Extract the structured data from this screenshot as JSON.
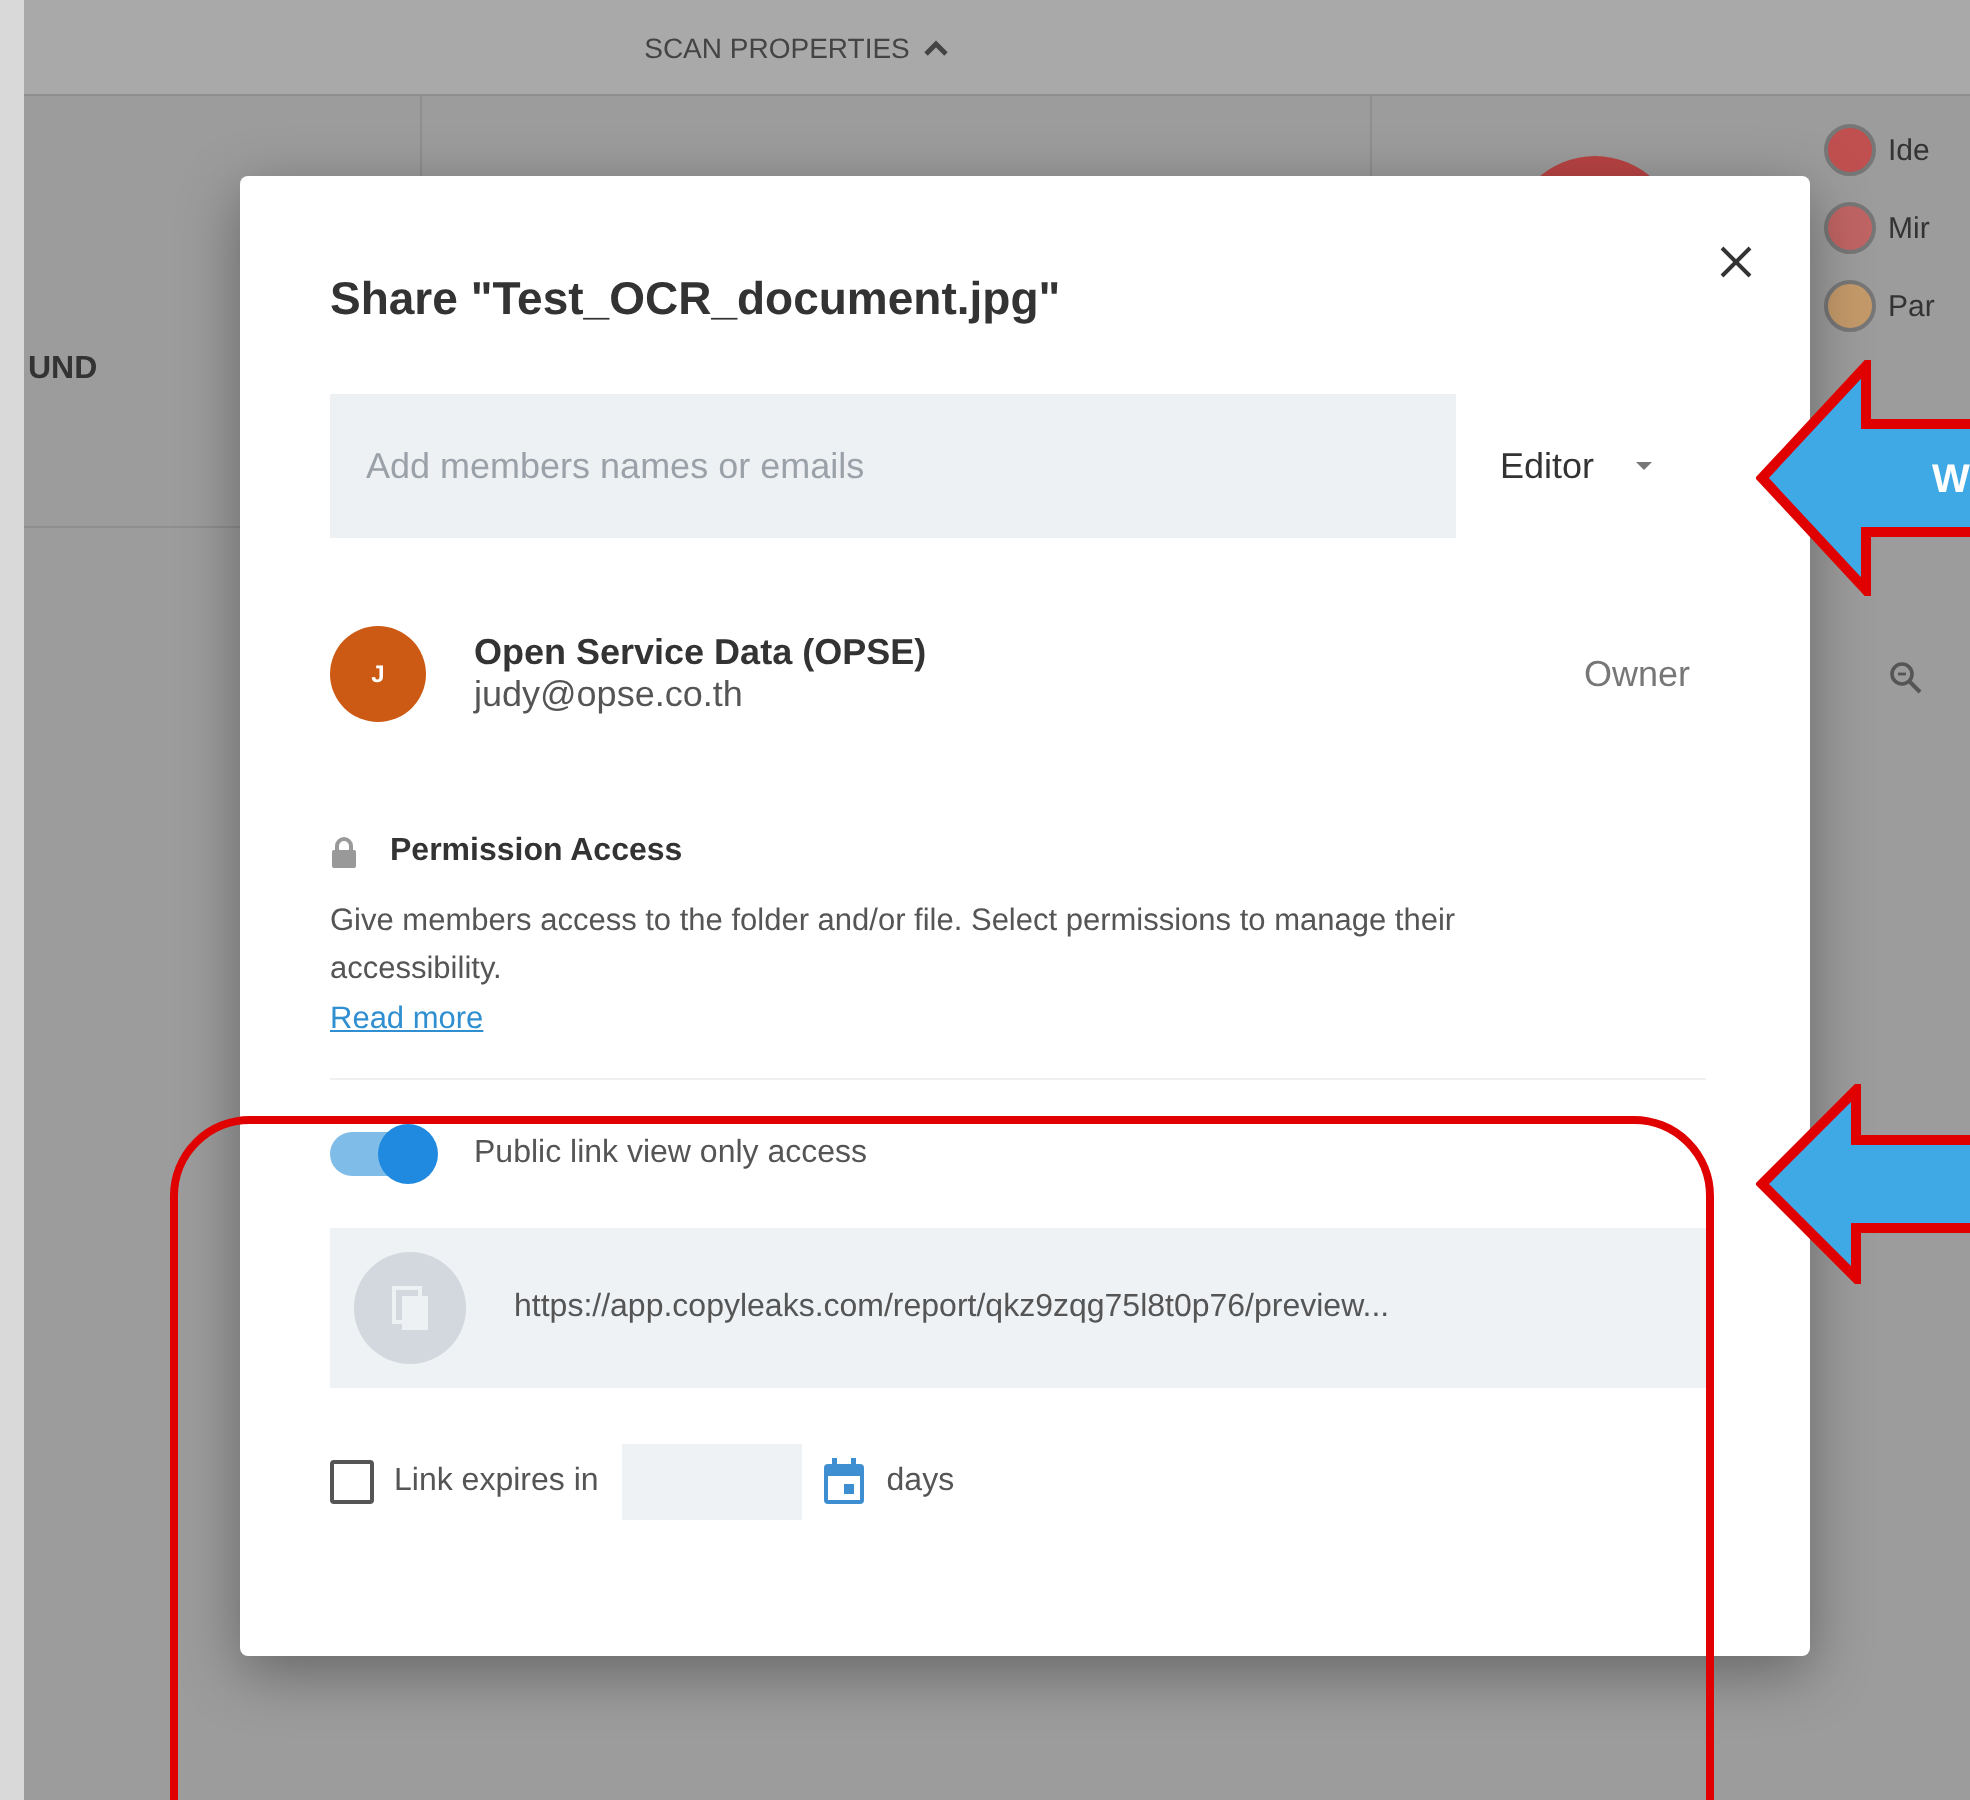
{
  "background": {
    "header": "SCAN PROPERTIES",
    "left_label": "UND",
    "legend": [
      {
        "label": "Ide",
        "color": "#c0504f"
      },
      {
        "label": "Mir",
        "color": "#c06464"
      },
      {
        "label": "Par",
        "color": "#c49a6a"
      }
    ]
  },
  "dialog": {
    "title": "Share \"Test_OCR_document.jpg\"",
    "invite": {
      "placeholder": "Add members names or emails",
      "role": "Editor"
    },
    "members": [
      {
        "initial": "J",
        "name": "Open Service Data (OPSE)",
        "email": "judy@opse.co.th",
        "role": "Owner"
      }
    ],
    "permission": {
      "title": "Permission Access",
      "text": "Give members access to the folder and/or file. Select permissions to manage their accessibility.",
      "link": "Read more"
    },
    "public_link": {
      "label": "Public link view only access",
      "on": true,
      "url": "https://app.copyleaks.com/report/qkz9zqg75l8t0p76/preview..."
    },
    "expiry": {
      "checked": false,
      "label": "Link expires in",
      "unit": "days"
    }
  },
  "annotations": {
    "arrow_text": "W"
  }
}
